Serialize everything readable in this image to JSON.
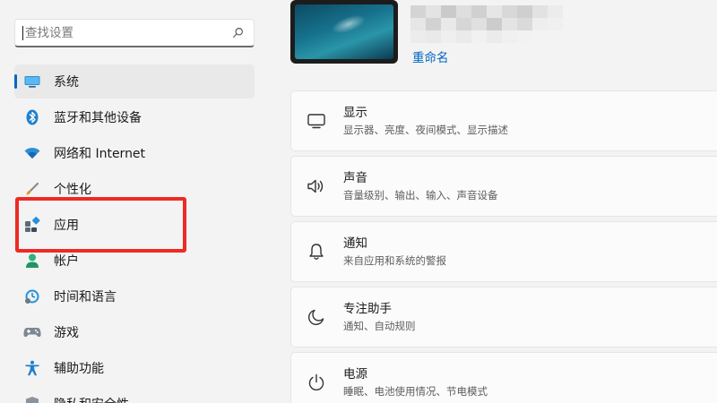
{
  "search": {
    "placeholder": "查找设置",
    "icon": "search-icon"
  },
  "sidebar": {
    "items": [
      {
        "label": "系统",
        "icon": "system-display-icon",
        "selected": true
      },
      {
        "label": "蓝牙和其他设备",
        "icon": "bluetooth-icon"
      },
      {
        "label": "网络和 Internet",
        "icon": "wifi-icon"
      },
      {
        "label": "个性化",
        "icon": "brush-icon"
      },
      {
        "label": "应用",
        "icon": "apps-icon"
      },
      {
        "label": "帐户",
        "icon": "account-icon"
      },
      {
        "label": "时间和语言",
        "icon": "time-language-icon"
      },
      {
        "label": "游戏",
        "icon": "gamepad-icon"
      },
      {
        "label": "辅助功能",
        "icon": "accessibility-icon"
      },
      {
        "label": "隐私和安全性",
        "icon": "shield-icon"
      }
    ]
  },
  "device": {
    "rename_link": "重命名"
  },
  "cards": [
    {
      "title": "显示",
      "desc": "显示器、亮度、夜间模式、显示描述",
      "icon": "monitor-icon"
    },
    {
      "title": "声音",
      "desc": "音量级别、输出、输入、声音设备",
      "icon": "speaker-icon"
    },
    {
      "title": "通知",
      "desc": "来自应用和系统的警报",
      "icon": "bell-icon"
    },
    {
      "title": "专注助手",
      "desc": "通知、自动规则",
      "icon": "moon-icon"
    },
    {
      "title": "电源",
      "desc": "睡眠、电池使用情况、节电模式",
      "icon": "power-icon"
    }
  ],
  "colors": {
    "accent": "#0067c0",
    "highlight_box": "#ee2a24",
    "background": "#f3f3f3"
  }
}
